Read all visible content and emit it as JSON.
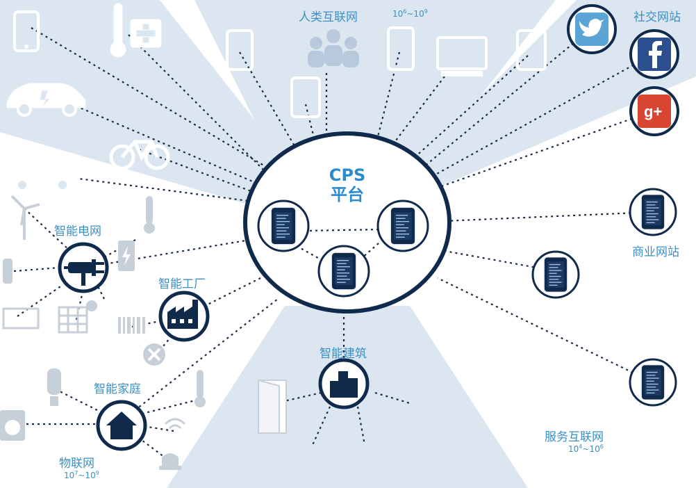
{
  "center": {
    "line1": "CPS",
    "line2": "平台"
  },
  "sectors": {
    "human_internet": {
      "label": "人类互联网",
      "range_base": "10",
      "range_exp1": "6",
      "range_sep": "~10",
      "range_exp2": "9"
    },
    "social_sites": {
      "label": "社交网站"
    },
    "business_sites": {
      "label": "商业网站"
    },
    "service_internet": {
      "label": "服务互联网",
      "range_base": "10",
      "range_exp1": "4",
      "range_sep": "~10",
      "range_exp2": "6"
    },
    "iot": {
      "label": "物联网",
      "range_base": "10",
      "range_exp1": "7",
      "range_sep": "~10",
      "range_exp2": "9"
    }
  },
  "hubs": {
    "smart_grid": "智能电网",
    "smart_factory": "智能工厂",
    "smart_home": "智能家庭",
    "smart_building": "智能建筑"
  },
  "icons": [
    "phone-icon",
    "thermometer-icon",
    "medical-cross-icon",
    "electric-car-icon",
    "bicycle-icon",
    "electric-car-icon",
    "wind-turbine-icon",
    "plug-icon",
    "battery-icon",
    "factory-icon",
    "house-icon",
    "building-icon",
    "twitter-icon",
    "facebook-icon",
    "google-plus-icon",
    "server-phone-icon",
    "people-icon",
    "tablet-icon",
    "monitor-icon",
    "door-icon",
    "washing-machine-icon",
    "light-bulb-icon",
    "alarm-icon",
    "solar-panel-icon",
    "tools-icon"
  ],
  "colors": {
    "navy": "#102a4c",
    "light_blue": "#dce6f1",
    "accent": "#3b8fc4"
  }
}
